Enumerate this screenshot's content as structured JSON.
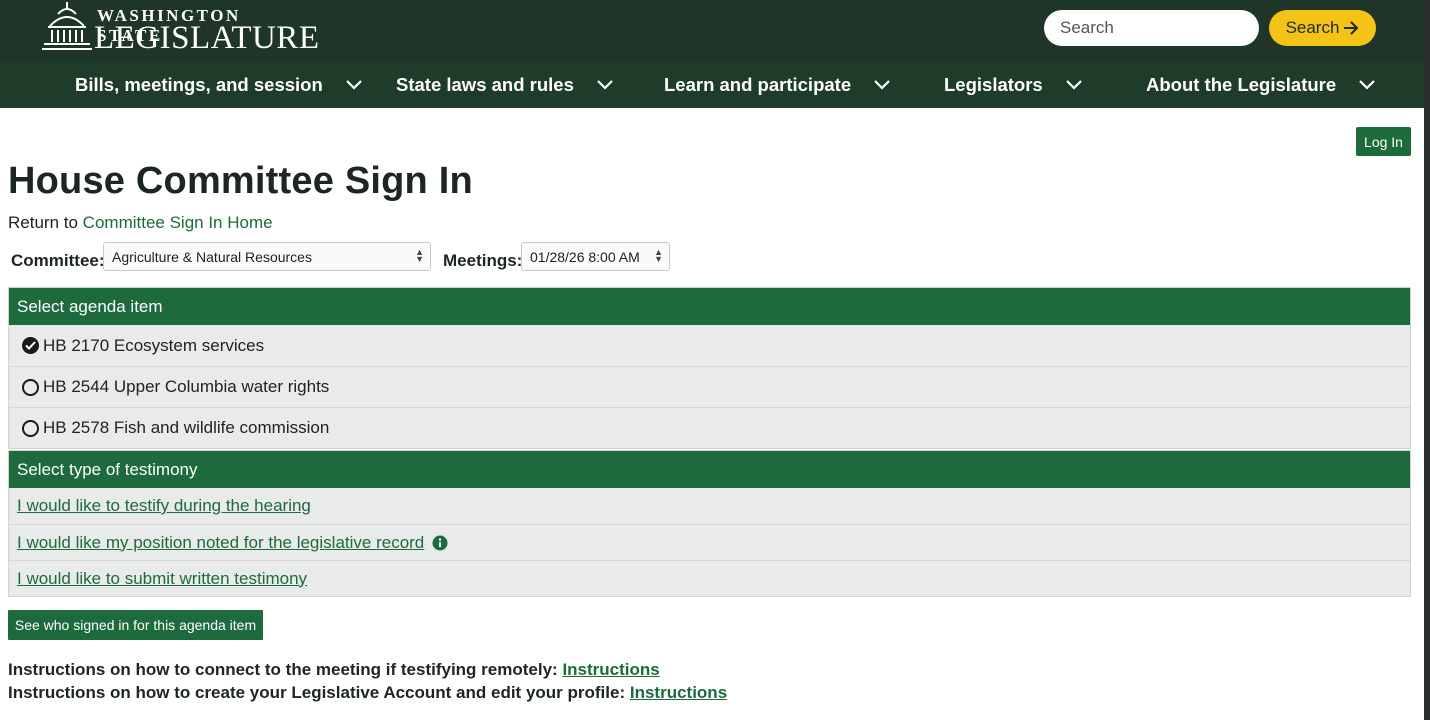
{
  "header": {
    "logo_line1": "WASHINGTON STATE",
    "logo_line2": "LEGISLATURE",
    "search_placeholder": "Search",
    "search_button": "Search",
    "nav": [
      {
        "label": "Bills, meetings, and session"
      },
      {
        "label": "State laws and rules"
      },
      {
        "label": "Learn and participate"
      },
      {
        "label": "Legislators"
      },
      {
        "label": "About the Legislature"
      }
    ]
  },
  "page": {
    "login_label": "Log In",
    "title": "House Committee Sign In",
    "return_prefix": "Return to",
    "return_link": "Committee Sign In Home",
    "committee_label": "Committee:",
    "committee_value": "Agriculture & Natural Resources",
    "meetings_label": "Meetings:",
    "meetings_value": "01/28/26 8:00 AM"
  },
  "agenda": {
    "header": "Select agenda item",
    "items": [
      {
        "label": "HB 2170 Ecosystem services",
        "selected": true
      },
      {
        "label": "HB 2544 Upper Columbia water rights",
        "selected": false
      },
      {
        "label": "HB 2578 Fish and wildlife commission",
        "selected": false
      }
    ]
  },
  "testimony": {
    "header": "Select type of testimony",
    "options": [
      {
        "label": "I would like to testify during the hearing"
      },
      {
        "label": "I would like my position noted for the legislative record"
      },
      {
        "label": "I would like to submit written testimony"
      }
    ]
  },
  "see_who_label": "See who signed in for this agenda item",
  "instructions": [
    {
      "text": "Instructions on how to connect to the meeting if testifying remotely:",
      "link": "Instructions"
    },
    {
      "text": "Instructions on how to create your Legislative Account and edit your profile:",
      "link": "Instructions"
    }
  ],
  "colors": {
    "brand_green": "#1d6a3c",
    "header_dark": "#1e3528",
    "search_yellow": "#f3c316"
  }
}
